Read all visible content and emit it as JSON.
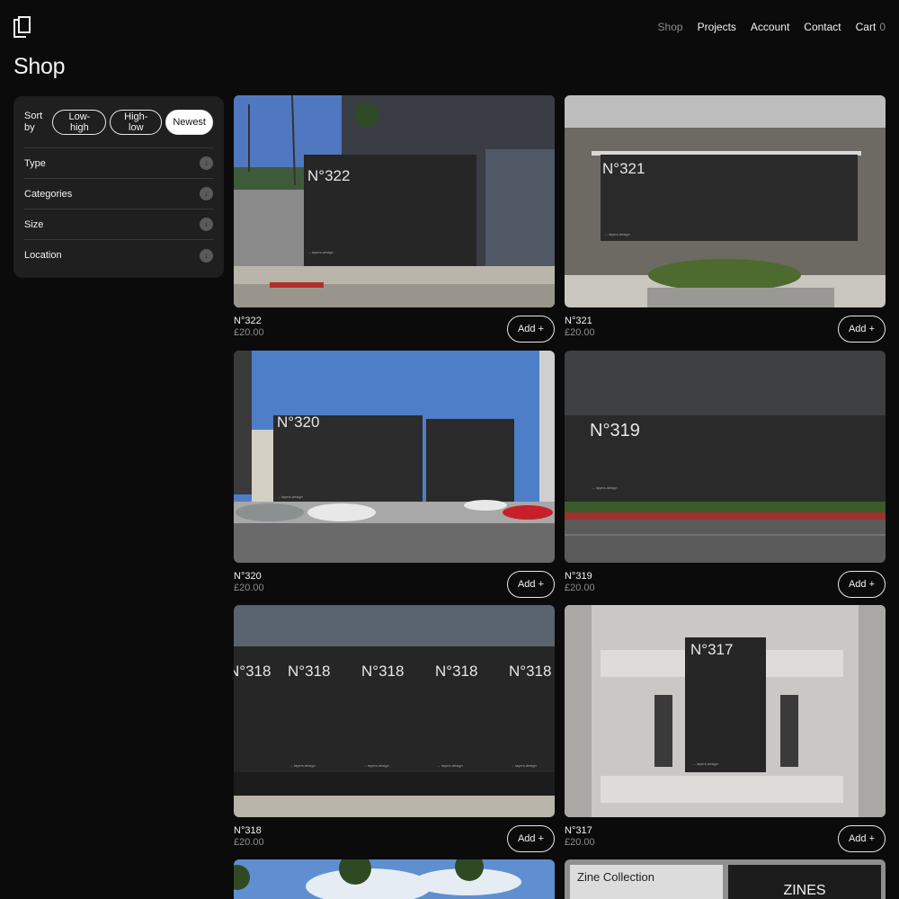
{
  "nav": {
    "items": [
      {
        "label": "Shop",
        "active": true
      },
      {
        "label": "Projects"
      },
      {
        "label": "Account"
      },
      {
        "label": "Contact"
      }
    ],
    "cart_label": "Cart",
    "cart_count": "0"
  },
  "page_title": "Shop",
  "sidebar": {
    "sort_label": "Sort by",
    "sort_options": [
      "Low-high",
      "High-low",
      "Newest"
    ],
    "sort_selected": "Newest",
    "filters": [
      "Type",
      "Categories",
      "Size",
      "Location"
    ]
  },
  "products": [
    {
      "name": "N°322",
      "price": "£20.00",
      "add_label": "Add +",
      "poster_label": "N°322"
    },
    {
      "name": "N°321",
      "price": "£20.00",
      "add_label": "Add +",
      "poster_label": "N°321"
    },
    {
      "name": "N°320",
      "price": "£20.00",
      "add_label": "Add +",
      "poster_label": "N°320"
    },
    {
      "name": "N°319",
      "price": "£20.00",
      "add_label": "Add +",
      "poster_label": "N°319"
    },
    {
      "name": "N°318",
      "price": "£20.00",
      "add_label": "Add +",
      "poster_label": "N°318"
    },
    {
      "name": "N°317",
      "price": "£20.00",
      "add_label": "Add +",
      "poster_label": "N°317"
    }
  ],
  "poster_small_text": "→ layers.design",
  "zine": {
    "left_title": "Zine Collection",
    "right_title": "ZINES"
  },
  "colors": {
    "background": "#0b0b0b",
    "panel": "#1f1f1f",
    "muted": "#8a8a8a"
  }
}
